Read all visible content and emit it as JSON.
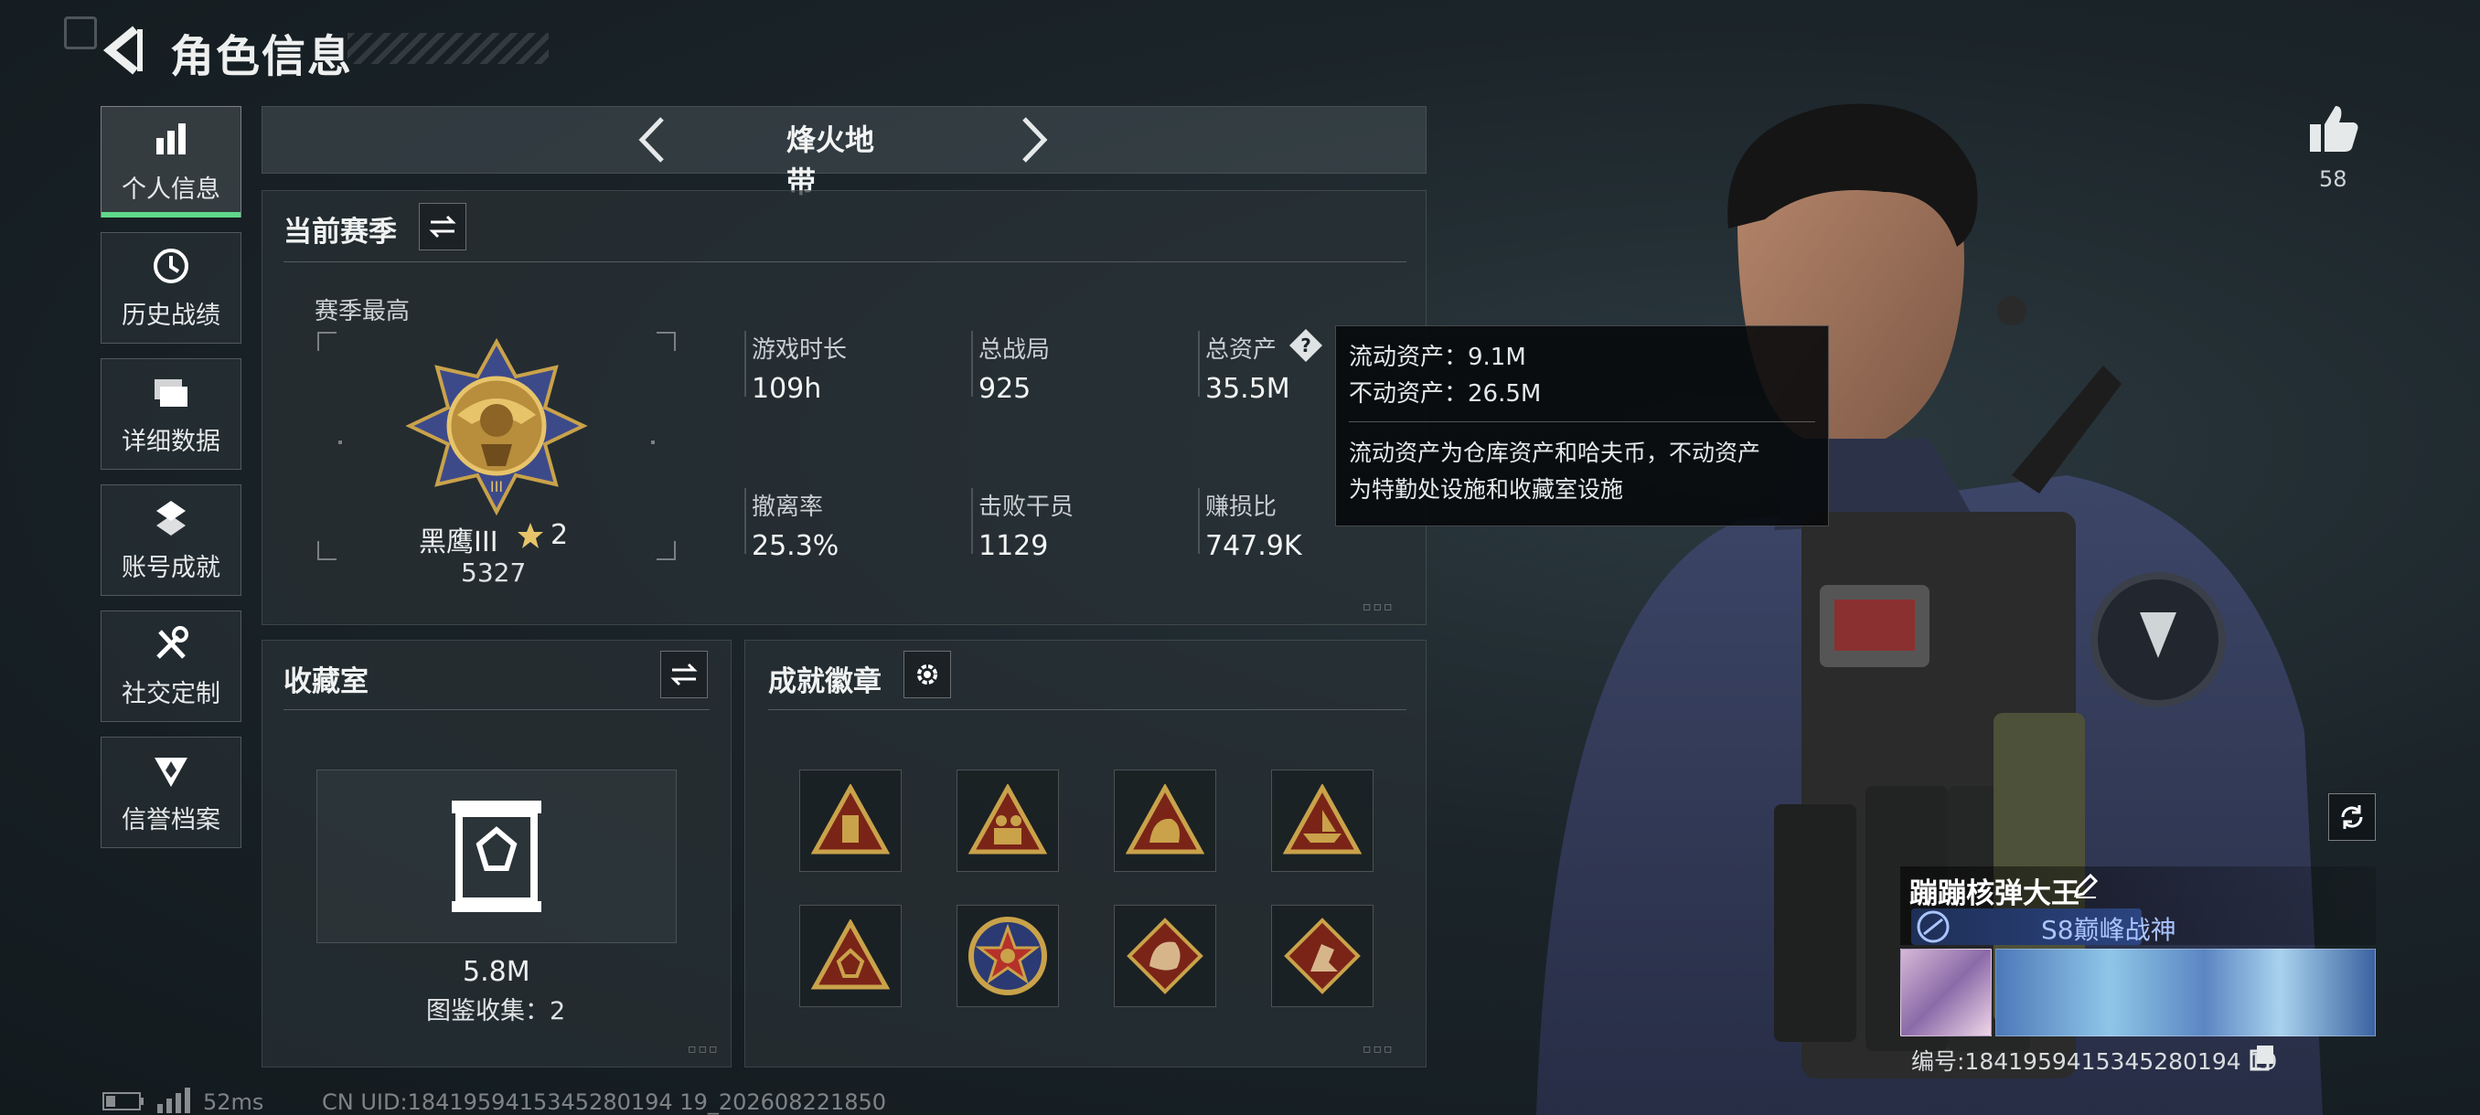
{
  "header": {
    "title": "角色信息"
  },
  "sidebar": {
    "items": [
      {
        "label": "个人信息",
        "icon": "bar-chart-icon",
        "active": true
      },
      {
        "label": "历史战绩",
        "icon": "clock-history-icon"
      },
      {
        "label": "详细数据",
        "icon": "folders-icon"
      },
      {
        "label": "账号成就",
        "icon": "achievement-badge-icon"
      },
      {
        "label": "社交定制",
        "icon": "tools-icon"
      },
      {
        "label": "信誉档案",
        "icon": "shield-emblem-icon"
      }
    ]
  },
  "mode_selector": {
    "label": "烽火地带"
  },
  "season": {
    "title": "当前赛季",
    "best_label": "赛季最高",
    "rank_name": "黑鹰III",
    "rank_stars": "2",
    "rank_points": "5327",
    "stats": [
      {
        "label": "游戏时长",
        "value": "109h"
      },
      {
        "label": "总战局",
        "value": "925"
      },
      {
        "label": "总资产",
        "value": "35.5M"
      },
      {
        "label": "撤离率",
        "value": "25.3%"
      },
      {
        "label": "击败干员",
        "value": "1129"
      },
      {
        "label": "赚损比",
        "value": "747.9K"
      }
    ]
  },
  "tooltip": {
    "liquid": "流动资产：9.1M",
    "fixed": "不动资产：26.5M",
    "desc_line1": "流动资产为仓库资产和哈夫币，不动资产",
    "desc_line2": "为特勤处设施和收藏室设施"
  },
  "collection": {
    "title": "收藏室",
    "value": "5.8M",
    "count_text": "图鉴收集：2"
  },
  "achievements": {
    "title": "成就徽章",
    "badges": [
      "triangle-tower-badge",
      "triangle-figures-badge",
      "triangle-creature-badge",
      "triangle-ship-badge",
      "triangle-eye-badge",
      "round-star-badge",
      "diamond-dragon-badge",
      "diamond-runner-badge"
    ]
  },
  "profile": {
    "name": "蹦蹦核弹大王",
    "title": "S8巅峰战神",
    "id_text": "编号:1841959415345280194 19",
    "likes": "58"
  },
  "status_bar": {
    "ping": "52ms",
    "uid": "CN UID:1841959415345280194 19_202608221850"
  },
  "colors": {
    "accent_green": "#5fd88a",
    "badge_gold": "#c9a24a",
    "badge_red": "#7a2418"
  }
}
